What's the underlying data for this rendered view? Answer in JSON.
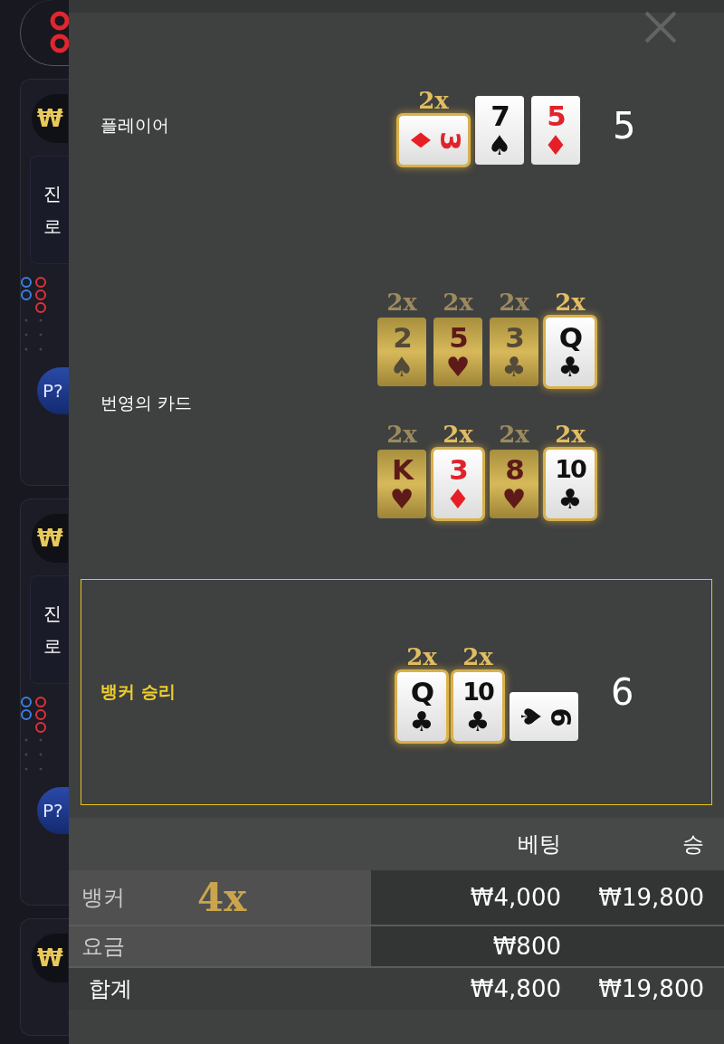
{
  "lobby_cards": [
    {
      "chip": "₩",
      "message_lines": [
        "진",
        "로"
      ],
      "button": "P?"
    },
    {
      "chip": "₩",
      "message_lines": [
        "진",
        "로"
      ],
      "button": "P?"
    },
    {
      "chip": "₩"
    }
  ],
  "result": {
    "player": {
      "label": "플레이어",
      "total": "5",
      "cards": [
        {
          "rank": "3",
          "suit": "♦",
          "kind": "glow",
          "sideways": true,
          "multiplier": "2x"
        },
        {
          "rank": "7",
          "suit": "♠",
          "kind": "plain",
          "sideways": false
        },
        {
          "rank": "5",
          "suit": "♦",
          "kind": "plain",
          "sideways": false
        }
      ]
    },
    "lucky_cards": {
      "label": "번영의 카드",
      "rows": [
        [
          {
            "rank": "2",
            "suit": "♠",
            "kind": "gold",
            "sideways": false,
            "multiplier": "2x"
          },
          {
            "rank": "5",
            "suit": "♥",
            "kind": "gold",
            "sideways": false,
            "multiplier": "2x"
          },
          {
            "rank": "3",
            "suit": "♣",
            "kind": "gold",
            "sideways": false,
            "multiplier": "2x"
          },
          {
            "rank": "Q",
            "suit": "♣",
            "kind": "glow",
            "sideways": false,
            "multiplier": "2x"
          }
        ],
        [
          {
            "rank": "K",
            "suit": "♥",
            "kind": "gold",
            "sideways": false,
            "multiplier": "2x"
          },
          {
            "rank": "3",
            "suit": "♦",
            "kind": "glow",
            "sideways": false,
            "multiplier": "2x"
          },
          {
            "rank": "8",
            "suit": "♥",
            "kind": "gold",
            "sideways": false,
            "multiplier": "2x"
          },
          {
            "rank": "10",
            "suit": "♣",
            "kind": "glow",
            "sideways": false,
            "multiplier": "2x"
          }
        ]
      ]
    },
    "banker": {
      "label": "뱅커 승리",
      "highlighted": true,
      "total": "6",
      "cards": [
        {
          "rank": "Q",
          "suit": "♣",
          "kind": "glow",
          "sideways": false,
          "multiplier": "2x"
        },
        {
          "rank": "10",
          "suit": "♣",
          "kind": "glow",
          "sideways": false,
          "multiplier": "2x"
        },
        {
          "rank": "6",
          "suit": "♠",
          "kind": "plain",
          "sideways": true
        }
      ]
    }
  },
  "bets": {
    "columns": [
      "베팅",
      "승"
    ],
    "rows": [
      {
        "kind": "line",
        "label": "뱅커",
        "multiplier": "4x",
        "bet": "₩4,000",
        "win": "₩19,800"
      },
      {
        "kind": "line",
        "label": "요금",
        "bet": "₩800"
      },
      {
        "kind": "total",
        "label": "합계",
        "bet": "₩4,800",
        "win": "₩19,800"
      }
    ]
  }
}
